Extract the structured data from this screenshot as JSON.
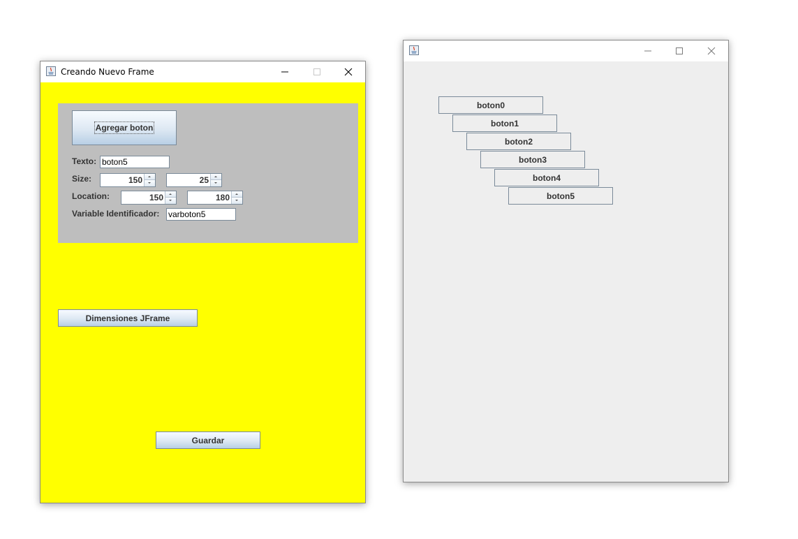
{
  "colors": {
    "frame1_background": "#ffff00",
    "panel_background": "#bebebe",
    "frame2_background": "#eeeeee"
  },
  "frame1": {
    "title": "Creando Nuevo Frame",
    "controls": [
      "minimize-icon",
      "maximize-icon",
      "close-icon"
    ],
    "form": {
      "add_button_label": "Agregar boton",
      "texto_label": "Texto:",
      "texto_value": "boton5",
      "size_label": "Size:",
      "size_width": "150",
      "size_height": "25",
      "location_label": "Location:",
      "location_x": "150",
      "location_y": "180",
      "var_label": "Variable Identificador:",
      "var_value": "varboton5"
    },
    "dimensions_button_label": "Dimensiones JFrame",
    "save_button_label": "Guardar"
  },
  "frame2": {
    "title": "",
    "controls": [
      "minimize-icon",
      "maximize-icon",
      "close-icon"
    ],
    "buttons": [
      "boton0",
      "boton1",
      "boton2",
      "boton3",
      "boton4",
      "boton5"
    ]
  }
}
